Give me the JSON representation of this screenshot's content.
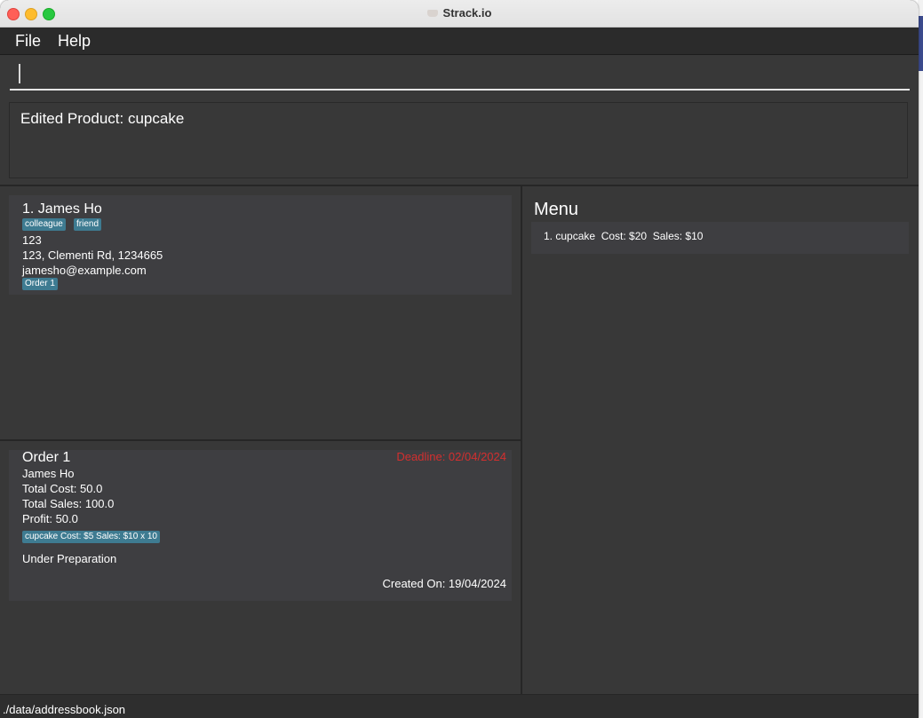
{
  "window": {
    "title": "Strack.io"
  },
  "menubar": {
    "file": "File",
    "help": "Help"
  },
  "command": {
    "value": "",
    "placeholder": ""
  },
  "result": {
    "text": "Edited Product: cupcake"
  },
  "persons": [
    {
      "name": "1.  James Ho",
      "tags": [
        "colleague",
        "friend"
      ],
      "phone": "123",
      "address": "123, Clementi Rd, 1234665",
      "email": "jamesho@example.com",
      "orders": [
        "Order 1"
      ]
    }
  ],
  "orders": [
    {
      "title": "Order 1",
      "deadline": "Deadline: 02/04/2024",
      "customer": "James Ho",
      "total_cost": "Total Cost: 50.0",
      "total_sales": "Total Sales: 100.0",
      "profit": "Profit: 50.0",
      "items": [
        "cupcake Cost: $5 Sales: $10 x 10"
      ],
      "status": "Under Preparation",
      "created": "Created On: 19/04/2024"
    }
  ],
  "menu": {
    "title": "Menu",
    "items": [
      "1. cupcake  Cost: $20  Sales: $10"
    ]
  },
  "status": {
    "path": "./data/addressbook.json"
  },
  "colors": {
    "background": "#383838",
    "card": "#3e3e41",
    "tag": "#3e7b91",
    "deadline": "#d32f2f"
  }
}
